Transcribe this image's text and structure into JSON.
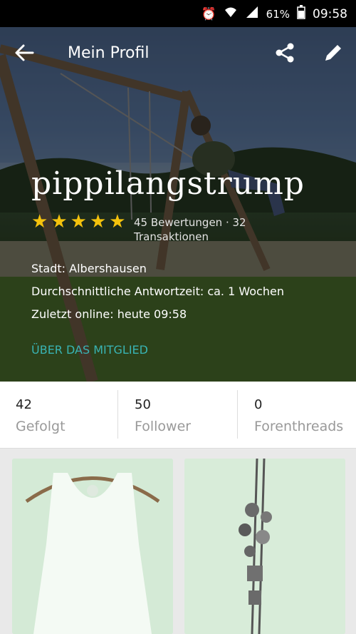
{
  "status_bar": {
    "battery_percent": "61%",
    "time": "09:58"
  },
  "header": {
    "title": "Mein Profil"
  },
  "profile": {
    "username": "pippilangstrump",
    "stars": 5,
    "rating_text": "45 Bewertungen · 32 Transaktionen",
    "city_label": "Stadt:",
    "city_value": "Albershausen",
    "response_label": "Durchschnittliche Antwortzeit:",
    "response_value": "ca. 1 Wochen",
    "online_label": "Zuletzt online:",
    "online_value": "heute 09:58",
    "about_link": "ÜBER DAS MITGLIED"
  },
  "stats": [
    {
      "count": "42",
      "label": "Gefolgt"
    },
    {
      "count": "50",
      "label": "Follower"
    },
    {
      "count": "0",
      "label": "Forenthreads"
    }
  ],
  "colors": {
    "accent": "#39b4b4",
    "star": "#f4c20d"
  }
}
